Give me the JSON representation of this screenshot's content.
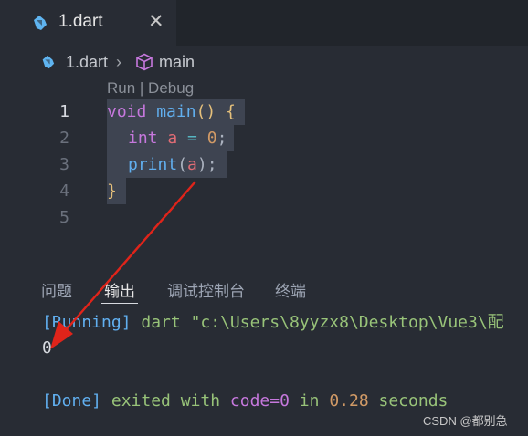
{
  "colors": {
    "accent_red": "#e0241a",
    "dart_icon": "#5fb4f0",
    "cube_icon": "#c678dd"
  },
  "editor_tab": {
    "label": "1.dart",
    "icon": "dart-icon",
    "close": "✕"
  },
  "breadcrumb": {
    "file": "1.dart",
    "symbol": "main",
    "file_icon": "dart-icon",
    "symbol_icon": "cube-icon",
    "separator": "›"
  },
  "codelens": "Run | Debug",
  "code": {
    "line_numbers": [
      "1",
      "2",
      "3",
      "4",
      "5"
    ],
    "lines": [
      {
        "t1": "void",
        "t2": " ",
        "t3": "main",
        "t4": "()",
        "t5": " ",
        "t6": "{"
      },
      {
        "t1": "int",
        "t2": " ",
        "t3": "a",
        "t4": " = ",
        "t5": "0",
        "t6": ";"
      },
      {
        "t1": "print",
        "t2": "(",
        "t3": "a",
        "t4": ")",
        "t5": ";"
      },
      {
        "t1": "}"
      }
    ]
  },
  "panel": {
    "tabs": [
      "问题",
      "输出",
      "调试控制台",
      "终端"
    ],
    "active_tab": "输出"
  },
  "output": {
    "running_tag": "[Running]",
    "running_cmd": " dart \"c:\\Users\\8yyzx8\\Desktop\\Vue3\\配",
    "result": "0",
    "done_tag": "[Done]",
    "done_w1": " exited with ",
    "done_code": "code=0",
    "done_w2": " in ",
    "done_time": "0.28",
    "done_w3": " seconds"
  },
  "watermark": "CSDN @都别急"
}
